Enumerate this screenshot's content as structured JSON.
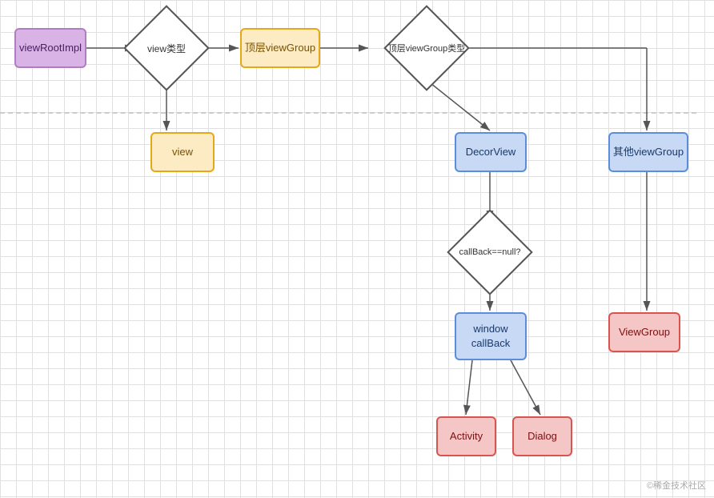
{
  "nodes": {
    "viewRootImpl": {
      "label": "viewRootImpl"
    },
    "viewType": {
      "label": "view类型"
    },
    "topViewGroup": {
      "label": "顶层viewGroup"
    },
    "topViewGroupType": {
      "label": "顶层viewGroup类型"
    },
    "view": {
      "label": "view"
    },
    "decorView": {
      "label": "DecorView"
    },
    "otherViewGroup": {
      "label": "其他viewGroup"
    },
    "callBackNull": {
      "label": "callBack==null?"
    },
    "windowCallBack": {
      "label": "window\ncallBack"
    },
    "viewGroup": {
      "label": "ViewGroup"
    },
    "activity": {
      "label": "Activity"
    },
    "dialog": {
      "label": "Dialog"
    }
  },
  "watermark": "©稀金技术社区"
}
